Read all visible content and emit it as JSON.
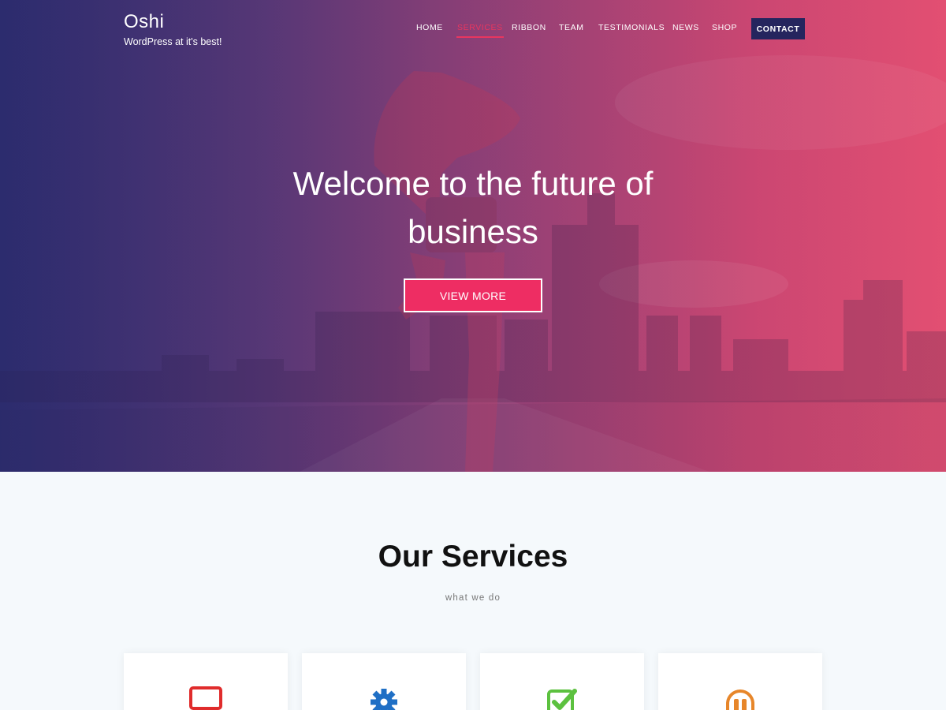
{
  "header": {
    "site_title": "Oshi",
    "tagline": "WordPress at it's best!",
    "nav": [
      {
        "label": "HOME",
        "active": false
      },
      {
        "label": "SERVICES",
        "active": true
      },
      {
        "label": "RIBBON",
        "active": false
      },
      {
        "label": "TEAM",
        "active": false
      },
      {
        "label": "TESTIMONIALS",
        "active": false
      },
      {
        "label": "NEWS",
        "active": false
      },
      {
        "label": "SHOP",
        "active": false
      }
    ],
    "contact_label": "CONTACT"
  },
  "hero": {
    "heading_line1": "Welcome to the future of",
    "heading_line2": "business",
    "button_label": "VIEW MORE"
  },
  "services": {
    "title": "Our Services",
    "subtitle": "what we do",
    "cards": [
      {
        "icon": "desktop-icon",
        "color": "#e02c2c"
      },
      {
        "icon": "gear-icon",
        "color": "#1f6fc5"
      },
      {
        "icon": "checkbox-icon",
        "color": "#5cc13f"
      },
      {
        "icon": "headphones-icon",
        "color": "#e7862a"
      }
    ]
  },
  "colors": {
    "accent": "#ee2d63",
    "navy": "#25255e",
    "active_nav": "#e8365f"
  }
}
